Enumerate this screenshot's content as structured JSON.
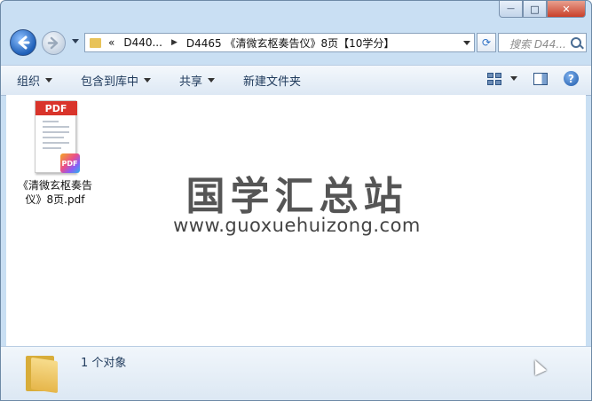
{
  "window": {
    "caption_buttons": {
      "minimize": "—",
      "maximize": "□",
      "close": "✕"
    }
  },
  "nav": {
    "address": {
      "chevron": "«",
      "segments": [
        "D440...",
        "D4465 《清微玄枢奏告仪》8页【10学分】"
      ]
    },
    "search_placeholder": "搜索 D44..."
  },
  "toolbar": {
    "organize": "组织",
    "include_library": "包含到库中",
    "share": "共享",
    "new_folder": "新建文件夹",
    "help": "?"
  },
  "files": [
    {
      "name": "《清微玄枢奏告仪》8页.pdf",
      "icon_label": "PDF",
      "badge": "PDF"
    }
  ],
  "watermark": {
    "title": "国学汇总站",
    "url": "www.guoxuehuizong.com"
  },
  "details": {
    "count": "1 个对象"
  },
  "colors": {
    "accent": "#1e395b",
    "pdf_red": "#d9342b",
    "folder": "#e8c35a"
  }
}
